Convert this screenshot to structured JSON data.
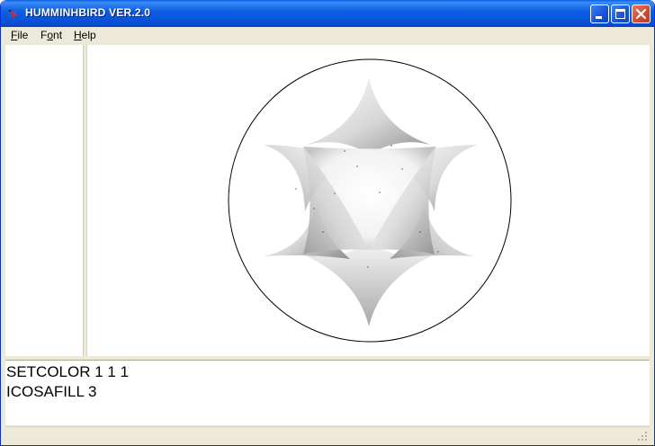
{
  "window": {
    "title": "HUMMINHBIRD VER.2.0",
    "app_icon": "hummingbird-icon",
    "controls": {
      "minimize": "minimize-icon",
      "maximize": "maximize-icon",
      "close": "close-icon"
    }
  },
  "menu": {
    "items": [
      {
        "mnemonic": "F",
        "rest": "ile"
      },
      {
        "pre": "F",
        "mnemonic": "o",
        "rest": "nt"
      },
      {
        "mnemonic": "H",
        "rest": "elp"
      }
    ]
  },
  "console": {
    "lines": [
      "SETCOLOR 1 1 1",
      "ICOSAFILL 3"
    ]
  },
  "colors": {
    "title_bar": "#0852d8",
    "chrome": "#ece9d8",
    "close_button": "#d5472b",
    "canvas": "#ffffff"
  }
}
